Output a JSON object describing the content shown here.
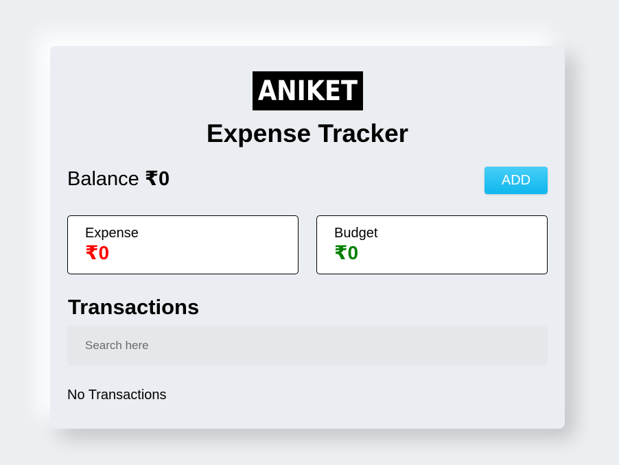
{
  "logo": {
    "text": "ANIKET"
  },
  "header": {
    "title": "Expense Tracker"
  },
  "balance": {
    "label": "Balance",
    "amount": "₹0"
  },
  "actions": {
    "add_label": "ADD"
  },
  "summary": {
    "expense": {
      "label": "Expense",
      "amount": "₹0",
      "color": "#ff0000"
    },
    "budget": {
      "label": "Budget",
      "amount": "₹0",
      "color": "#008000"
    }
  },
  "transactions": {
    "title": "Transactions",
    "search_placeholder": "Search here",
    "empty_text": "No Transactions"
  },
  "colors": {
    "accent": "#1ec2f2",
    "background": "#eaedf1"
  }
}
